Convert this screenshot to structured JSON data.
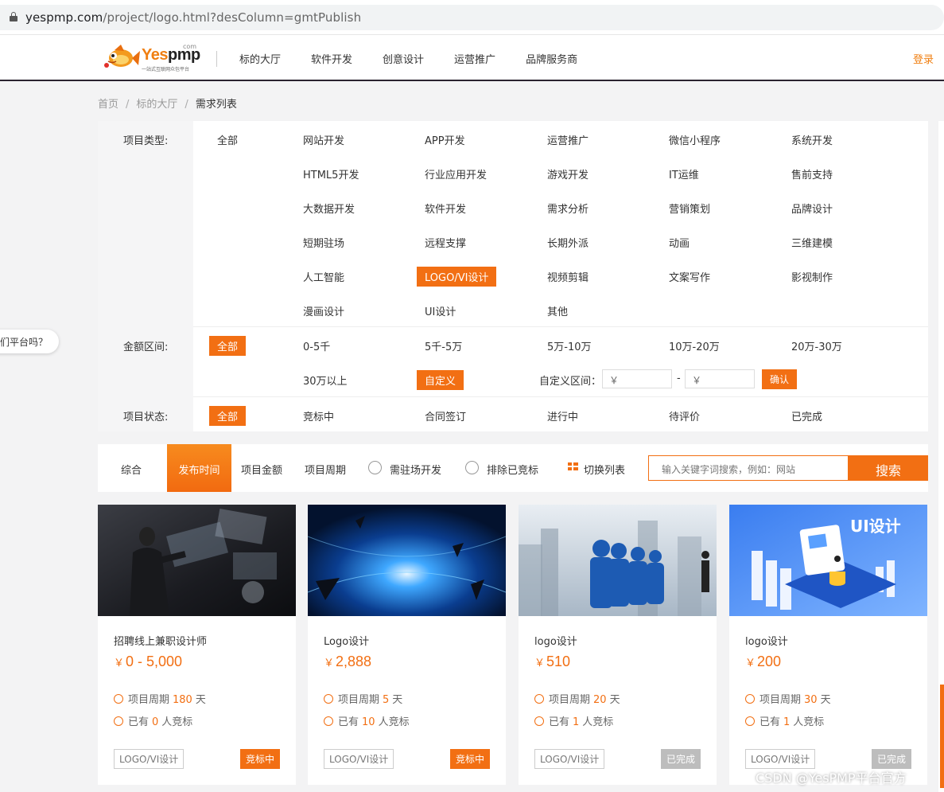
{
  "browser": {
    "url_host": "yespmp.com",
    "url_path": "/project/logo.html?desColumn=gmtPublish"
  },
  "header": {
    "brand": "Yes",
    "brand_suffix": "pmp",
    "brand_com": "com",
    "brand_tagline": "一站式互联网众包平台",
    "nav": [
      "标的大厅",
      "软件开发",
      "创意设计",
      "运营推广",
      "品牌服务商"
    ],
    "login": "登录"
  },
  "breadcrumb": {
    "home": "首页",
    "hall": "标的大厅",
    "current": "需求列表",
    "sep": "/"
  },
  "chat_bubble": "们平台吗？",
  "filter": {
    "type_label": "项目类型:",
    "type_all": "全部",
    "types": [
      [
        "网站开发",
        "APP开发",
        "运营推广",
        "微信小程序",
        "系统开发"
      ],
      [
        "HTML5开发",
        "行业应用开发",
        "游戏开发",
        "IT运维",
        "售前支持"
      ],
      [
        "大数据开发",
        "软件开发",
        "需求分析",
        "营销策划",
        "品牌设计"
      ],
      [
        "短期驻场",
        "远程支撑",
        "长期外派",
        "动画",
        "三维建模"
      ],
      [
        "人工智能",
        "LOGO/VI设计",
        "视频剪辑",
        "文案写作",
        "影视制作"
      ],
      [
        "漫画设计",
        "UI设计",
        "其他",
        "",
        ""
      ]
    ],
    "amount_label": "金额区间:",
    "amount_all": "全部",
    "amounts": [
      "0-5千",
      "5千-5万",
      "5万-10万",
      "10万-20万",
      "20万-30万"
    ],
    "amount_more": "30万以上",
    "amount_custom": "自定义",
    "custom_range_label": "自定义区间：",
    "custom_min_placeholder": "￥",
    "custom_max_placeholder": "￥",
    "custom_dash": "-",
    "confirm": "确认",
    "status_label": "项目状态:",
    "status_all": "全部",
    "statuses": [
      "竞标中",
      "合同签订",
      "进行中",
      "待评价",
      "已完成"
    ]
  },
  "sortbar": {
    "items": [
      "综合",
      "发布时间",
      "项目金额",
      "项目周期"
    ],
    "radio1": "需驻场开发",
    "radio2": "排除已竞标",
    "switch_view": "切换列表",
    "search_placeholder": "输入关键字词搜索，例如：网站",
    "search_button": "搜索"
  },
  "cards": [
    {
      "title": "招聘线上兼职设计师",
      "currency": "￥",
      "price": "0 - 5,000",
      "period_label": "项目周期",
      "period": "180",
      "period_unit": "天",
      "bids_prefix": "已有",
      "bids": "0",
      "bids_suffix": "人竞标",
      "tag": "LOGO/VI设计",
      "status": "竞标中",
      "status_type": "bidding"
    },
    {
      "title": "Logo设计",
      "currency": "￥",
      "price": "2,888",
      "period_label": "项目周期",
      "period": "5",
      "period_unit": "天",
      "bids_prefix": "已有",
      "bids": "10",
      "bids_suffix": "人竞标",
      "tag": "LOGO/VI设计",
      "status": "竞标中",
      "status_type": "bidding"
    },
    {
      "title": "logo设计",
      "currency": "￥",
      "price": "510",
      "period_label": "项目周期",
      "period": "20",
      "period_unit": "天",
      "bids_prefix": "已有",
      "bids": "1",
      "bids_suffix": "人竞标",
      "tag": "LOGO/VI设计",
      "status": "已完成",
      "status_type": "done"
    },
    {
      "title": "logo设计",
      "currency": "￥",
      "price": "200",
      "period_label": "项目周期",
      "period": "30",
      "period_unit": "天",
      "bids_prefix": "已有",
      "bids": "1",
      "bids_suffix": "人竞标",
      "tag": "LOGO/VI设计",
      "status": "已完成",
      "status_type": "done",
      "image_text": "UI设计"
    }
  ],
  "watermark": "CSDN @YesPMP平台官方",
  "colors": {
    "accent": "#f26f13",
    "header_rule": "#2a2330"
  }
}
